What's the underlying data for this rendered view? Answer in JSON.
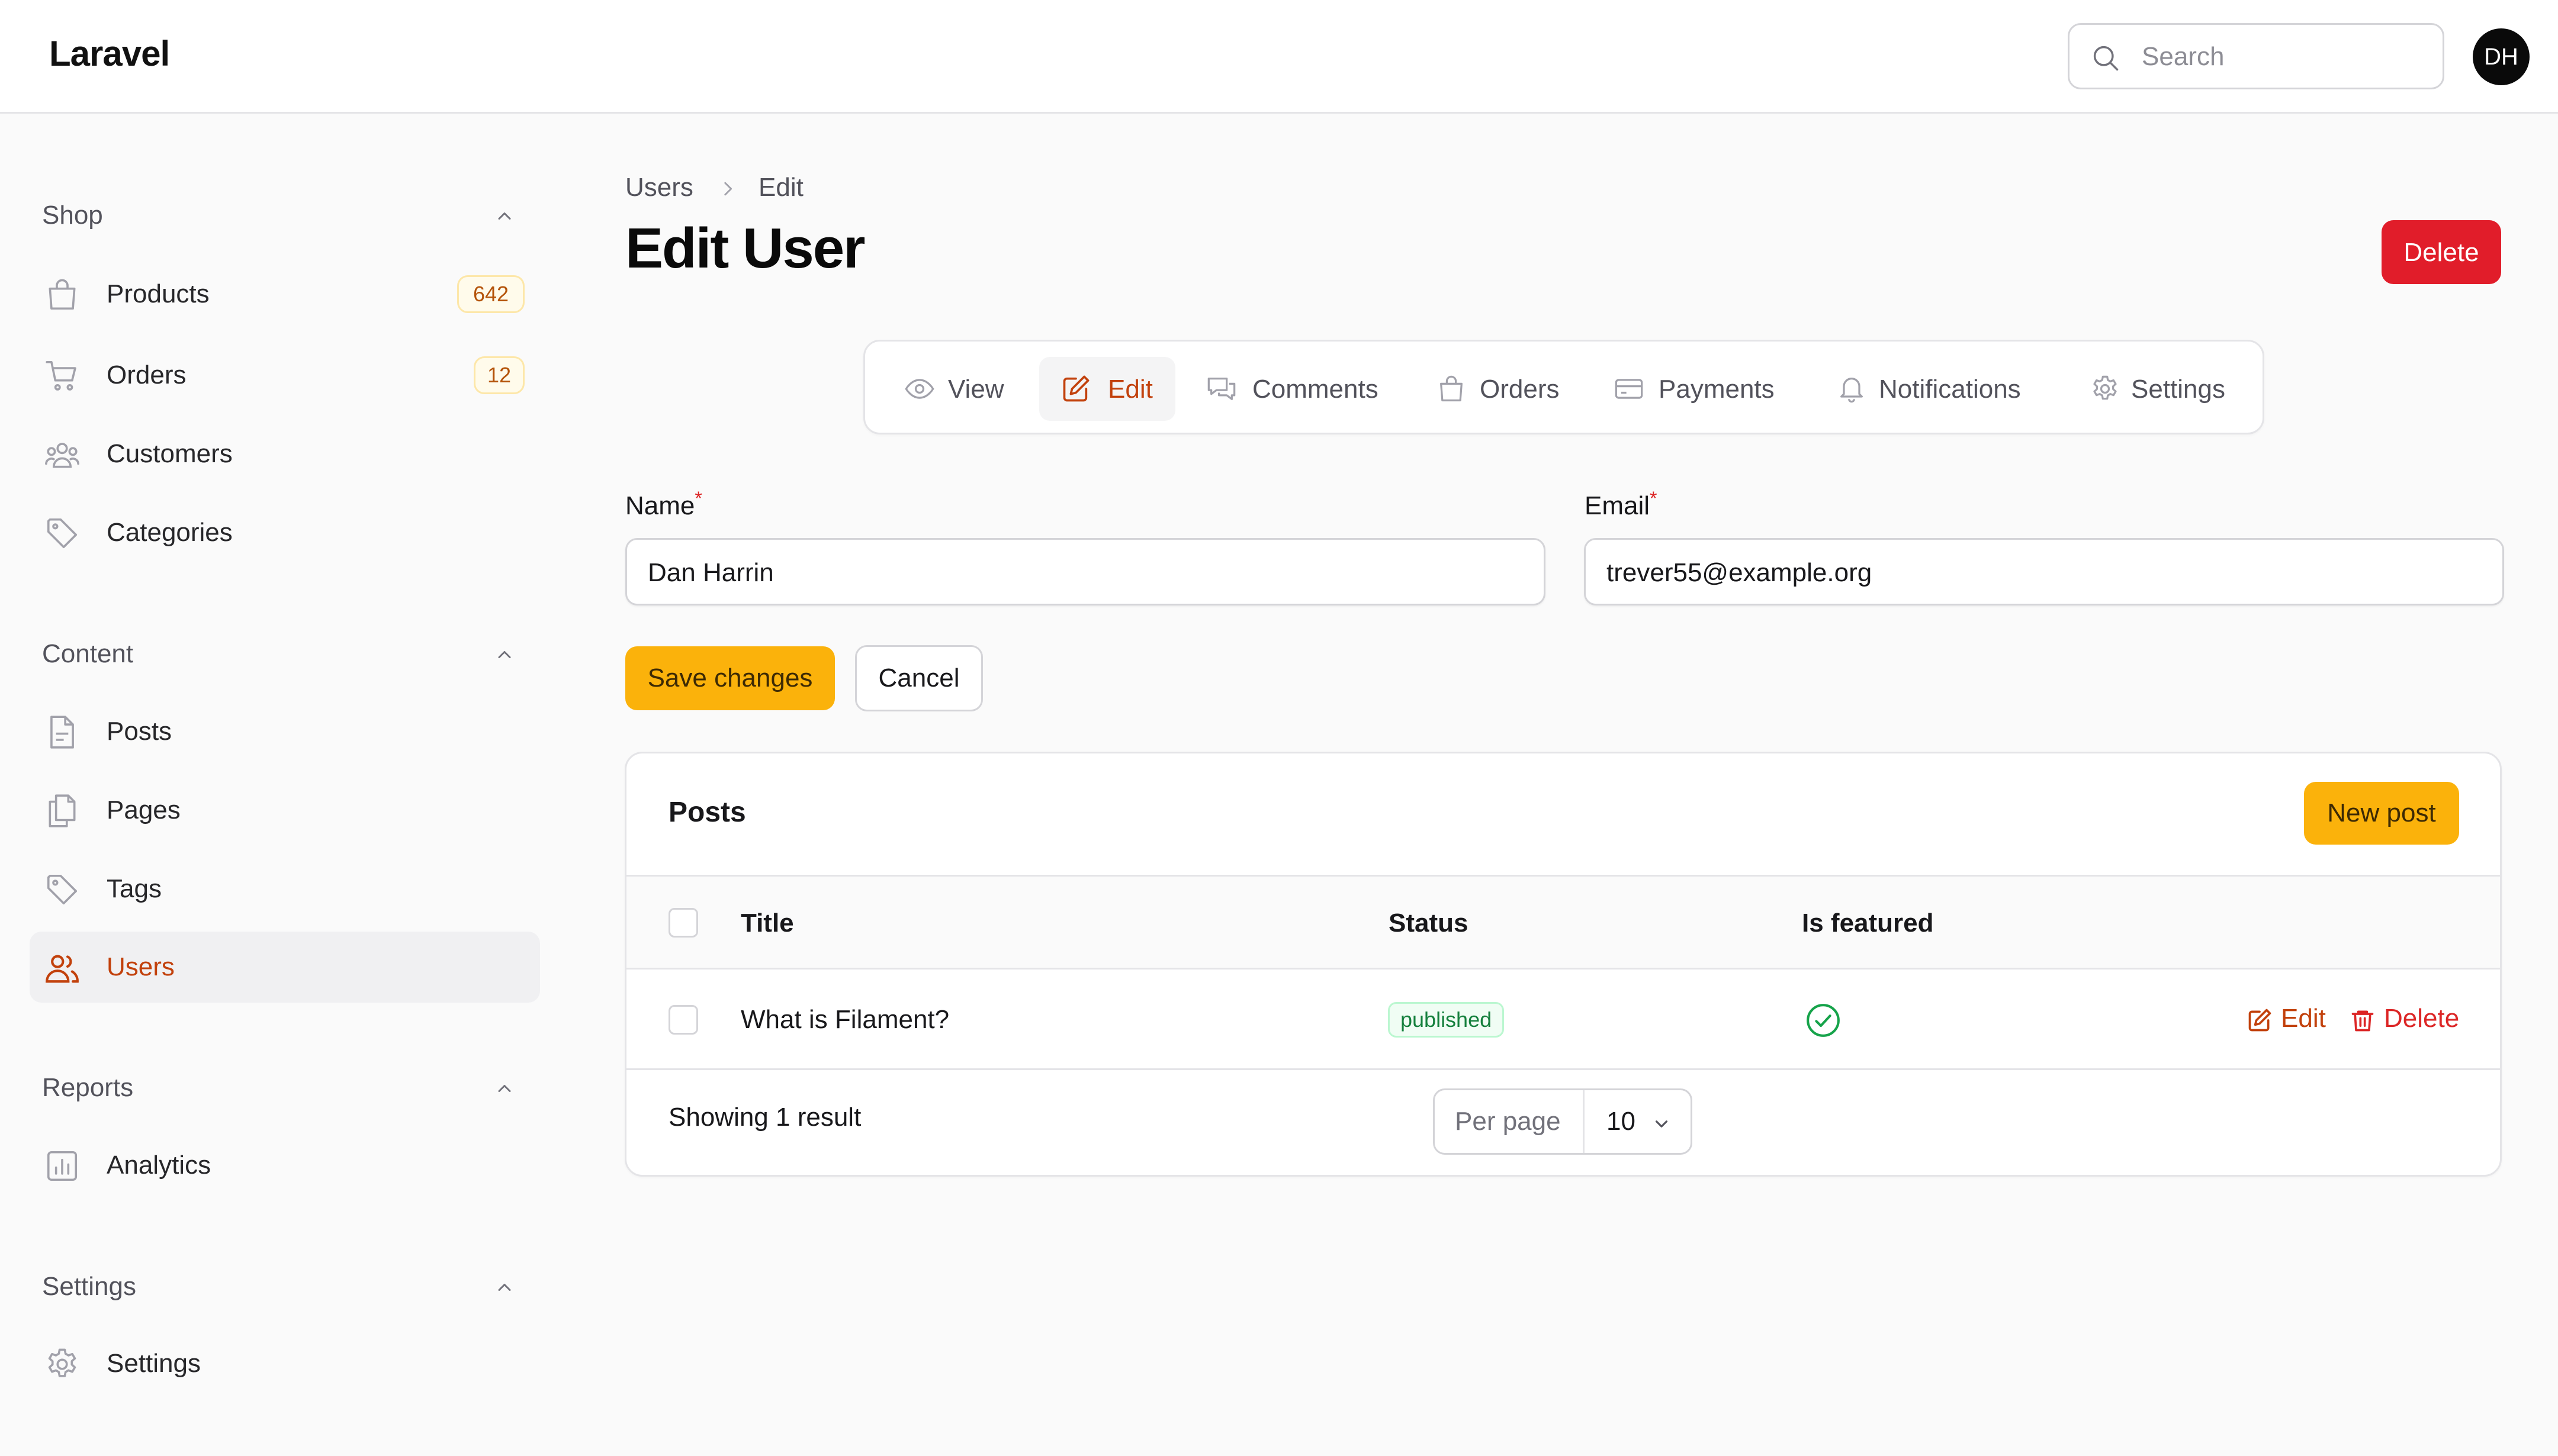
{
  "app": {
    "brand": "Laravel"
  },
  "topbar": {
    "search_placeholder": "Search",
    "avatar_initials": "DH"
  },
  "sidebar": {
    "groups": [
      {
        "label": "Shop",
        "items": [
          {
            "label": "Products",
            "icon": "shopping-bag-icon",
            "badge": "642"
          },
          {
            "label": "Orders",
            "icon": "shopping-cart-icon",
            "badge": "12"
          },
          {
            "label": "Customers",
            "icon": "users-group-icon"
          },
          {
            "label": "Categories",
            "icon": "tag-icon"
          }
        ]
      },
      {
        "label": "Content",
        "items": [
          {
            "label": "Posts",
            "icon": "document-icon"
          },
          {
            "label": "Pages",
            "icon": "documents-icon"
          },
          {
            "label": "Tags",
            "icon": "tag-icon"
          },
          {
            "label": "Users",
            "icon": "users-icon",
            "active": true
          }
        ]
      },
      {
        "label": "Reports",
        "items": [
          {
            "label": "Analytics",
            "icon": "chart-icon"
          }
        ]
      },
      {
        "label": "Settings",
        "items": [
          {
            "label": "Settings",
            "icon": "gear-icon"
          }
        ]
      }
    ]
  },
  "breadcrumb": [
    "Users",
    "Edit"
  ],
  "page": {
    "title": "Edit User",
    "delete_label": "Delete"
  },
  "tabs": [
    {
      "label": "View",
      "icon": "eye-icon"
    },
    {
      "label": "Edit",
      "icon": "pencil-square-icon",
      "active": true
    },
    {
      "label": "Comments",
      "icon": "chat-bubbles-icon"
    },
    {
      "label": "Orders",
      "icon": "shopping-bag-icon"
    },
    {
      "label": "Payments",
      "icon": "credit-card-icon"
    },
    {
      "label": "Notifications",
      "icon": "bell-icon"
    },
    {
      "label": "Settings",
      "icon": "gear-icon"
    }
  ],
  "form": {
    "name_label": "Name",
    "name_value": "Dan Harrin",
    "email_label": "Email",
    "email_value": "trever55@example.org",
    "required_mark": "*",
    "save_label": "Save changes",
    "cancel_label": "Cancel"
  },
  "posts": {
    "title": "Posts",
    "new_label": "New post",
    "columns": [
      "Title",
      "Status",
      "Is featured"
    ],
    "rows": [
      {
        "title": "What is Filament?",
        "status": "published",
        "is_featured": true,
        "edit_label": "Edit",
        "delete_label": "Delete"
      }
    ],
    "footer": {
      "result_text": "Showing 1 result",
      "per_page_label": "Per page",
      "per_page_value": "10"
    }
  },
  "colors": {
    "primary": "#fbb20b",
    "active_text": "#c2410c",
    "danger": "#e11d2a",
    "success": "#15803d"
  }
}
